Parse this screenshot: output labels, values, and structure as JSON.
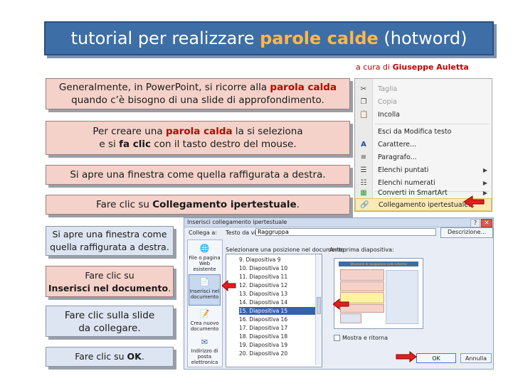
{
  "title": {
    "prefix": "tutorial per realizzare ",
    "highlight": "parole calde",
    "suffix": " (hotword)"
  },
  "author": {
    "prefix": "a cura di ",
    "name": "Giuseppe Auletta"
  },
  "steps": {
    "s1": {
      "line1_pre": "Generalmente, in PowerPoint, si ricorre alla ",
      "line1_hl": "parola calda",
      "line2": "quando c’è bisogno di una slide di  approfondimento."
    },
    "s2": {
      "line1_pre": "Per creare una ",
      "line1_hl": "parola calda",
      "line1_post": " la si seleziona",
      "line2_pre": "e si ",
      "line2_b": "fa clic",
      "line2_post": " con il tasto destro del mouse."
    },
    "s3": {
      "text": "Si apre una finestra come quella raffigurata a destra."
    },
    "s4": {
      "pre": "Fare clic su ",
      "b": "Collegamento ipertestuale",
      "post": "."
    },
    "s5": {
      "line1": "Si apre una finestra come",
      "line2": "quella raffigurata a destra."
    },
    "s6": {
      "line1": "Fare clic su",
      "line2_b": "Inserisci nel documento",
      "line2_post": "."
    },
    "s7": {
      "line1": "Fare clic sulla slide",
      "line2": "da collegare."
    },
    "s8": {
      "pre": "Fare clic su ",
      "b": "OK",
      "post": "."
    }
  },
  "context_menu": {
    "items": [
      {
        "label": "Taglia",
        "icon": "scissors-icon",
        "glyph": "✂",
        "disabled": true
      },
      {
        "label": "Copia",
        "icon": "copy-icon",
        "glyph": "❐",
        "disabled": true
      },
      {
        "label": "Incolla",
        "icon": "paste-icon",
        "glyph": "📋",
        "disabled": false
      },
      {
        "label": "Esci da Modifica testo",
        "icon": "",
        "glyph": "",
        "disabled": false
      },
      {
        "label": "Carattere...",
        "icon": "font-icon",
        "glyph": "A",
        "disabled": false
      },
      {
        "label": "Paragrafo...",
        "icon": "paragraph-icon",
        "glyph": "≡",
        "disabled": false
      },
      {
        "label": "Elenchi puntati",
        "icon": "bullets-icon",
        "glyph": "☰",
        "disabled": false
      },
      {
        "label": "Elenchi numerati",
        "icon": "numbering-icon",
        "glyph": "☷",
        "disabled": false
      },
      {
        "label": "Converti in SmartArt",
        "icon": "smartart-icon",
        "glyph": "▦",
        "disabled": false
      },
      {
        "label": "Collegamento ipertestuale...",
        "icon": "hyperlink-icon",
        "glyph": "🔗",
        "disabled": false
      }
    ],
    "submenu_arrow": "▶"
  },
  "dialog": {
    "title": "Inserisci collegamento ipertestuale",
    "help": "?",
    "close": "✕",
    "collega_a": "Collega a:",
    "testo_label": "Testo da visualizzare:",
    "testo_value": "Raggruppa",
    "descrizione_btn": "Descrizione...",
    "posizione_label": "Selezionare una posizione nel documento:",
    "anteprima_label": "Anteprima diapositiva:",
    "linkbar": [
      {
        "line1": "File o pagina",
        "line2": "Web esistente",
        "icon": "web-file-icon",
        "glyph": "🌐"
      },
      {
        "line1": "Inserisci nel",
        "line2": "documento",
        "icon": "document-place-icon",
        "glyph": "📄"
      },
      {
        "line1": "Crea nuovo",
        "line2": "documento",
        "icon": "new-document-icon",
        "glyph": "📝"
      },
      {
        "line1": "Indirizzo di",
        "line2": "posta",
        "line3": "elettronica",
        "icon": "email-icon",
        "glyph": "✉"
      }
    ],
    "slides": [
      "9. Diapositiva 9",
      "10. Diapositiva 10",
      "11. Diapositiva 11",
      "12. Diapositiva 12",
      "13. Diapositiva 13",
      "14. Diapositiva 14",
      "15. Diapositiva 15",
      "16. Diapositiva 16",
      "17. Diapositiva 17",
      "18. Diapositiva 18",
      "19. Diapositiva 19",
      "20. Diapositiva 20"
    ],
    "selected_slide": "15. Diapositiva 15",
    "preview_title": "Strumenti di navigazione sulle schermo",
    "mostra": "Mostra e ritorna",
    "ok": "OK",
    "annulla": "Annulla"
  },
  "colors": {
    "accent": "#3d6ea5",
    "highlight": "#ffb64d",
    "red": "#c00000",
    "step_bg": "#f4d2c9"
  }
}
